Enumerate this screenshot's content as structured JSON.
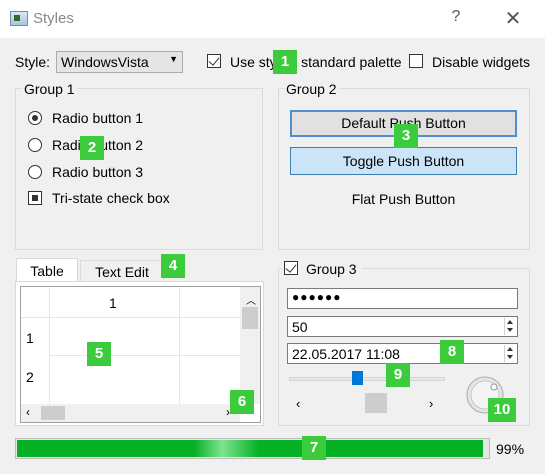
{
  "window": {
    "title": "Styles",
    "help": "?",
    "close": "✕"
  },
  "top": {
    "style_label": "Style:",
    "style_value": "WindowsVista",
    "use_palette_label": "Use style's standard palette",
    "use_palette_checked": true,
    "disable_widgets_label": "Disable widgets",
    "disable_widgets_checked": false
  },
  "group1": {
    "title": "Group 1",
    "radios": [
      {
        "label": "Radio button 1",
        "checked": true
      },
      {
        "label": "Radio button 2",
        "checked": false
      },
      {
        "label": "Radio button 3",
        "checked": false
      }
    ],
    "tristate_label": "Tri-state check box"
  },
  "group2": {
    "title": "Group 2",
    "default_button": "Default Push Button",
    "toggle_button": "Toggle Push Button",
    "flat_button": "Flat Push Button"
  },
  "tabs": {
    "items": [
      "Table",
      "Text Edit"
    ],
    "active": 0,
    "table": {
      "column_header": "1",
      "row_headers": [
        "1",
        "2"
      ]
    }
  },
  "group3": {
    "title": "Group 3",
    "checked": true,
    "password": "●●●●●●",
    "spin_value": "50",
    "datetime_value": "22.05.2017 11:08",
    "slider_value": 0.42
  },
  "progress": {
    "text": "99%",
    "value": 0.99,
    "color": "#06b025"
  },
  "badges": [
    "1",
    "2",
    "3",
    "4",
    "5",
    "6",
    "7",
    "8",
    "9",
    "10"
  ]
}
